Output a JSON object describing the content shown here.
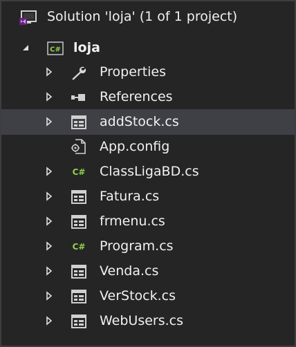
{
  "solution_explorer": {
    "solution_label": "Solution 'loja' (1 of 1 project)",
    "project_label": "loja",
    "items": [
      {
        "label": "Properties",
        "icon": "wrench-icon",
        "expandable": true
      },
      {
        "label": "References",
        "icon": "references-icon",
        "expandable": true
      },
      {
        "label": "addStock.cs",
        "icon": "form-file-icon",
        "expandable": true,
        "selected": true
      },
      {
        "label": "App.config",
        "icon": "config-file-icon",
        "expandable": false
      },
      {
        "label": "ClassLigaBD.cs",
        "icon": "csharp-file-icon",
        "expandable": true
      },
      {
        "label": "Fatura.cs",
        "icon": "form-file-icon",
        "expandable": true
      },
      {
        "label": "frmenu.cs",
        "icon": "form-file-icon",
        "expandable": true
      },
      {
        "label": "Program.cs",
        "icon": "csharp-file-icon",
        "expandable": true
      },
      {
        "label": "Venda.cs",
        "icon": "form-file-icon",
        "expandable": true
      },
      {
        "label": "VerStock.cs",
        "icon": "form-file-icon",
        "expandable": true
      },
      {
        "label": "WebUsers.cs",
        "icon": "form-file-icon",
        "expandable": true
      }
    ],
    "colors": {
      "background": "#252526",
      "selected_row": "#3f3f46",
      "text": "#f1f1f1",
      "csharp_green": "#8fd14f",
      "vs_purple": "#9b59d0"
    }
  }
}
